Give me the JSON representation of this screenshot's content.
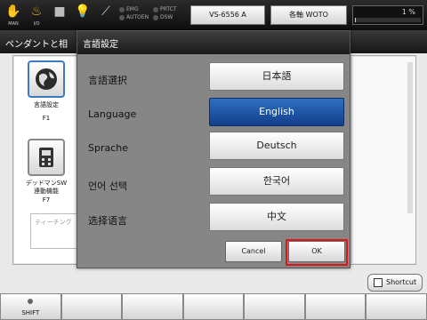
{
  "status_bar": {
    "icons": [
      {
        "icon": "hand-icon",
        "caption": "MAN"
      },
      {
        "icon": "io-signal-icon",
        "caption": "I/O"
      },
      {
        "icon": "stop-icon",
        "caption": ""
      },
      {
        "icon": "lightbulb-icon",
        "caption": ""
      },
      {
        "icon": "wrench-icon",
        "caption": ""
      }
    ],
    "lamps_left": [
      "EMG",
      "AUTOEN"
    ],
    "lamps_right": [
      "PRTCT",
      "DSW"
    ],
    "robot_model": "VS-6556 A",
    "axis_mode": "各軸 WOTO",
    "speed_percent": "1 %",
    "speed_fraction": 0.01
  },
  "background": {
    "title": "ペンダントと相",
    "nav": [
      {
        "label": "言語設定",
        "sub": "F1"
      },
      {
        "label": "デッドマンSW\n連動機能",
        "sub": "F7"
      }
    ],
    "field_text": "ティーチング"
  },
  "dialog": {
    "title": "言語設定",
    "rows": [
      {
        "label": "言語選択",
        "value": "日本語"
      },
      {
        "label": "Language",
        "value": "English"
      },
      {
        "label": "Sprache",
        "value": "Deutsch"
      },
      {
        "label": "언어 선택",
        "value": "한국어"
      },
      {
        "label": "选择语言",
        "value": "中文"
      }
    ],
    "selected_index": 1,
    "cancel_label": "Cancel",
    "ok_label": "OK"
  },
  "bottom": {
    "shortcut_label": "Shortcut",
    "fkeys": [
      "SHIFT",
      "",
      "",
      "",
      "",
      "",
      ""
    ]
  },
  "colors": {
    "selected": "#1f55a8",
    "highlight": "#e01515"
  }
}
